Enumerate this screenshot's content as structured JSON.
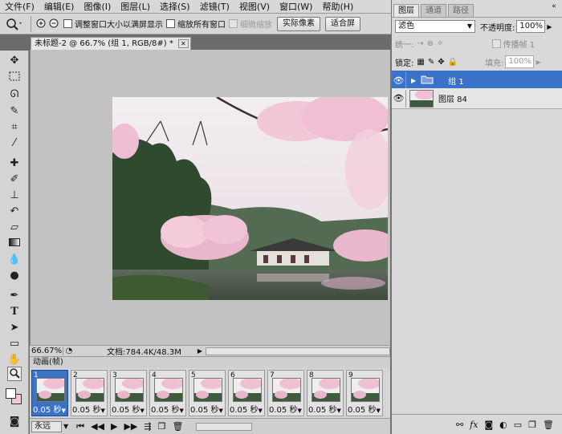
{
  "menu": {
    "items": [
      "文件(F)",
      "编辑(E)",
      "图像(I)",
      "图层(L)",
      "选择(S)",
      "滤镜(T)",
      "视图(V)",
      "窗口(W)",
      "帮助(H)"
    ]
  },
  "options": {
    "resize_window": "调整窗口大小以满屏显示",
    "zoom_all": "缩放所有窗口",
    "scrubby_zoom": "细微缩放",
    "actual_pixels": "实际像素",
    "fit_screen": "适合屏"
  },
  "document": {
    "tab_title": "未标题-2 @ 66.7% (组 1, RGB/8#) *",
    "zoom": "66.67%",
    "doc_size": "文档:784.4K/48.3M"
  },
  "animation": {
    "title": "动画(帧)",
    "frames": [
      {
        "num": "1",
        "delay": "0.05 秒"
      },
      {
        "num": "2",
        "delay": "0.05 秒"
      },
      {
        "num": "3",
        "delay": "0.05 秒"
      },
      {
        "num": "4",
        "delay": "0.05 秒"
      },
      {
        "num": "5",
        "delay": "0.05 秒"
      },
      {
        "num": "6",
        "delay": "0.05 秒"
      },
      {
        "num": "7",
        "delay": "0.05 秒"
      },
      {
        "num": "8",
        "delay": "0.05 秒"
      },
      {
        "num": "9",
        "delay": "0.05 秒"
      }
    ],
    "loop": "永远"
  },
  "panel": {
    "tabs": [
      "图层",
      "通道",
      "路径"
    ],
    "blend_mode": "滤色",
    "opacity_label": "不透明度:",
    "opacity_value": "100%",
    "unify_label": "统一:",
    "propagate_label": "传播帧 1",
    "lock_label": "锁定:",
    "fill_label": "填充:",
    "fill_value": "100%",
    "layers": [
      {
        "name": "组 1",
        "type": "group",
        "selected": true
      },
      {
        "name": "图层 84",
        "type": "image",
        "selected": false
      }
    ]
  },
  "colors": {
    "selection": "#3a72c8",
    "blossom": "#f1c6d8"
  }
}
